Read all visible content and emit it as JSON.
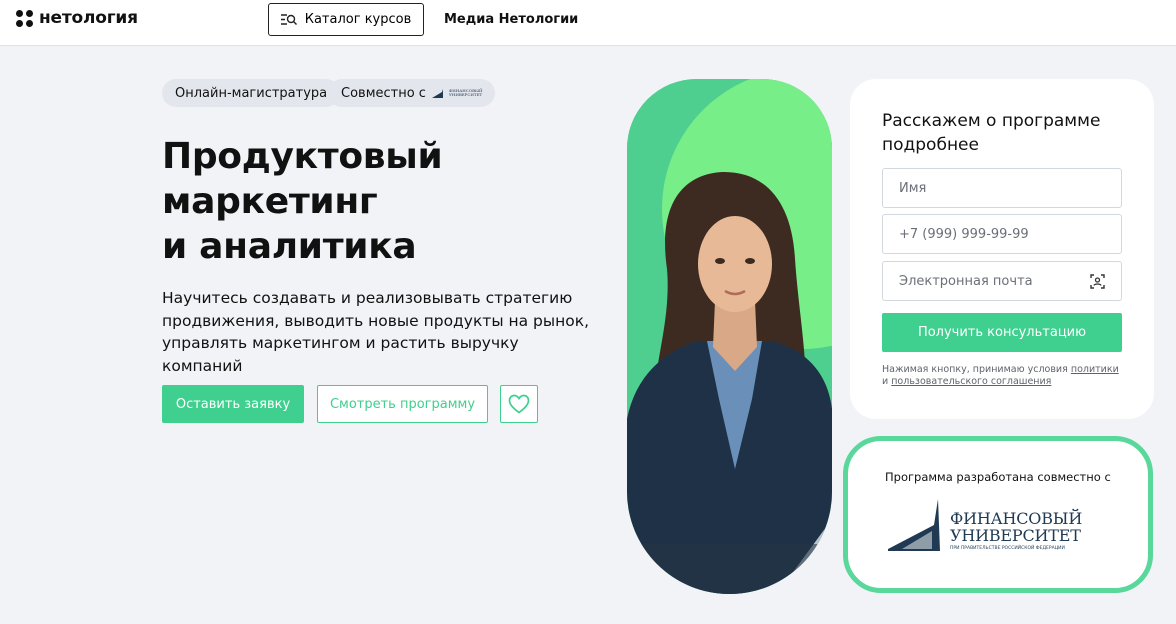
{
  "header": {
    "logo_text": "нетология",
    "catalog_label": "Каталог курсов",
    "media_label": "Медиа Нетологии"
  },
  "hero": {
    "tag_online": "Онлайн-магистратура",
    "tag_together": "Совместно с",
    "title_lines": [
      "Продуктовый",
      "маркетинг",
      "и аналитика"
    ],
    "description": "Научитесь создавать и реализовывать стратегию продвижения, выводить новые продукты на рынок, управлять маркетингом и растить выручку компаний",
    "apply_label": "Оставить заявку",
    "program_label": "Смотреть программу"
  },
  "form": {
    "title": "Расскажем о программе подробнее",
    "name_placeholder": "Имя",
    "phone_placeholder": "+7 (999) 999-99-99",
    "email_placeholder": "Электронная почта",
    "submit_label": "Получить консультацию",
    "consent_prefix": "Нажимая кнопку, принимаю условия",
    "consent_policy": "политики",
    "consent_and": "и",
    "consent_agreement": "пользовательского соглашения"
  },
  "partner": {
    "text": "Программа разработана совместно с",
    "logo_line1": "ФИНАНСОВЫЙ",
    "logo_line2": "УНИВЕРСИТЕТ",
    "logo_sub": "ПРИ ПРАВИТЕЛЬСТВЕ РОССИЙСКОЙ ФЕДЕРАЦИИ"
  },
  "colors": {
    "accent": "#3fcf8e",
    "accent_light": "#77ee88",
    "background": "#f1f3f7",
    "logo_navy": "#1f3a52"
  },
  "icons": [
    "logo-mark-icon",
    "catalog-search-icon",
    "heart-icon",
    "contact-scan-icon"
  ]
}
